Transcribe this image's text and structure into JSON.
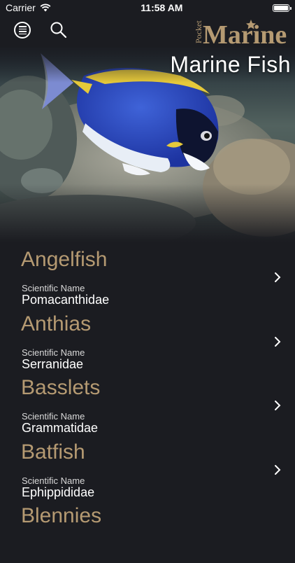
{
  "status": {
    "carrier": "Carrier",
    "time": "11:58 AM"
  },
  "header": {
    "logo_small": "Pocket",
    "logo_main": "Marine",
    "title": "Marine Fish"
  },
  "list": {
    "sci_label": "Scientific Name",
    "items": [
      {
        "name": "Angelfish",
        "scientific": "Pomacanthidae"
      },
      {
        "name": "Anthias",
        "scientific": "Serranidae"
      },
      {
        "name": "Basslets",
        "scientific": "Grammatidae"
      },
      {
        "name": "Batfish",
        "scientific": "Ephippididae"
      },
      {
        "name": "Blennies",
        "scientific": ""
      }
    ]
  },
  "colors": {
    "background": "#1b1c21",
    "accent": "#b59a72"
  }
}
